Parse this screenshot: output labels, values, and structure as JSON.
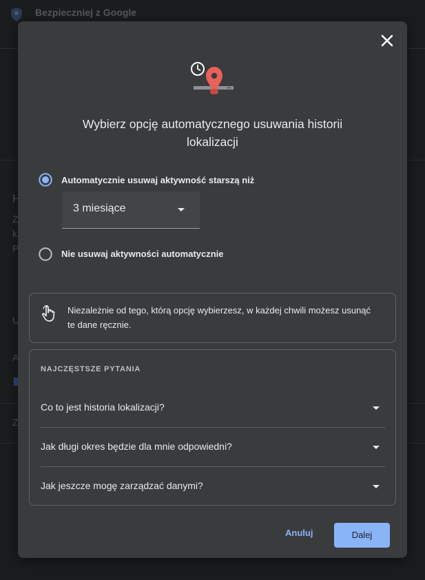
{
  "background": {
    "header_title": "Bezpieczniej z Google",
    "letters": [
      "H",
      "Z",
      "k",
      "P",
      "U",
      "A",
      "Z"
    ]
  },
  "dialog": {
    "title": "Wybierz opcję automatycznego usuwania historii lokalizacji",
    "options": [
      {
        "label": "Automatycznie usuwaj aktywność starszą niż",
        "selected": true
      },
      {
        "label": "Nie usuwaj aktywności automatycznie",
        "selected": false
      }
    ],
    "select_value": "3 miesiące",
    "info_text": "Niezależnie od tego, którą opcję wybierzesz, w każdej chwili możesz usunąć te dane ręcznie.",
    "faq": {
      "header": "NAJCZĘSTSZE PYTANIA",
      "items": [
        "Co to jest historia lokalizacji?",
        "Jak długi okres będzie dla mnie odpowiedni?",
        "Jak jeszcze mogę zarządzać danymi?"
      ]
    },
    "buttons": {
      "cancel": "Anuluj",
      "next": "Dalej"
    }
  },
  "colors": {
    "accent": "#8ab4f8",
    "dialog_bg": "#3a3b3d",
    "marker_red": "#e8615a"
  }
}
